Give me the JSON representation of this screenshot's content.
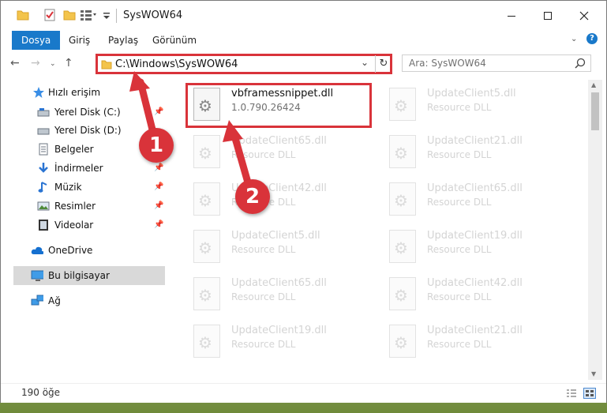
{
  "window": {
    "title": "SysWOW64"
  },
  "ribbon": {
    "tabs": [
      "Dosya",
      "Giriş",
      "Paylaş",
      "Görünüm"
    ]
  },
  "address": {
    "path": "C:\\Windows\\SysWOW64"
  },
  "search": {
    "placeholder": "Ara: SysWOW64"
  },
  "sidebar": {
    "items": [
      {
        "label": "Hızlı erişim",
        "icon": "star-icon"
      },
      {
        "label": "Yerel Disk (C:)",
        "icon": "drive-icon"
      },
      {
        "label": "Yerel Disk (D:)",
        "icon": "drive-icon"
      },
      {
        "label": "Belgeler",
        "icon": "documents-icon"
      },
      {
        "label": "İndirmeler",
        "icon": "download-icon"
      },
      {
        "label": "Müzik",
        "icon": "music-icon"
      },
      {
        "label": "Resimler",
        "icon": "pictures-icon"
      },
      {
        "label": "Videolar",
        "icon": "videos-icon"
      },
      {
        "label": "OneDrive",
        "icon": "cloud-icon"
      },
      {
        "label": "Bu bilgisayar",
        "icon": "computer-icon"
      },
      {
        "label": "Ağ",
        "icon": "network-icon"
      }
    ]
  },
  "files": [
    {
      "name": "vbframessnippet.dll",
      "sub": "1.0.790.26424"
    },
    {
      "name": "UpdateClient5.dll",
      "sub": "Resource DLL"
    },
    {
      "name": "UpdateClient65.dll",
      "sub": "Resource DLL"
    },
    {
      "name": "UpdateClient21.dll",
      "sub": "Resource DLL"
    },
    {
      "name": "UpdateClient42.dll",
      "sub": "Resource DLL"
    },
    {
      "name": "UpdateClient65.dll",
      "sub": "Resource DLL"
    },
    {
      "name": "UpdateClient5.dll",
      "sub": "Resource DLL"
    },
    {
      "name": "UpdateClient19.dll",
      "sub": "Resource DLL"
    },
    {
      "name": "UpdateClient65.dll",
      "sub": "Resource DLL"
    },
    {
      "name": "UpdateClient42.dll",
      "sub": "Resource DLL"
    },
    {
      "name": "UpdateClient19.dll",
      "sub": "Resource DLL"
    },
    {
      "name": "UpdateClient21.dll",
      "sub": "Resource DLL"
    }
  ],
  "status": {
    "count": "190 öğe"
  },
  "annotations": {
    "step1": "1",
    "step2": "2",
    "color": "#d9333a"
  }
}
